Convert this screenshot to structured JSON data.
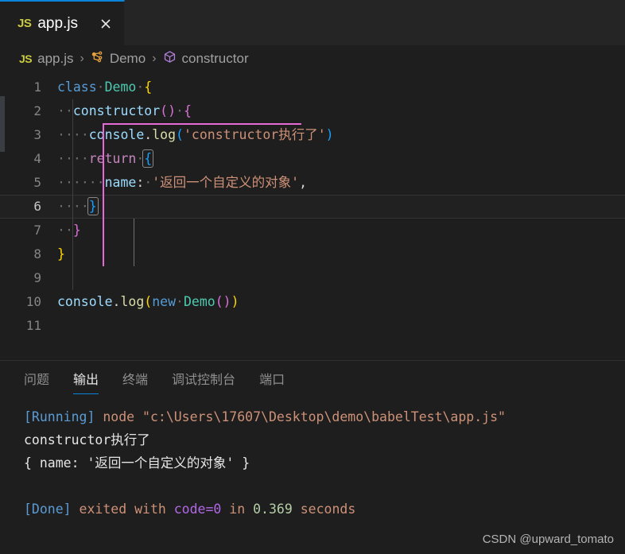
{
  "tab": {
    "file_type_badge": "JS",
    "label": "app.js",
    "close_icon": "close-icon"
  },
  "breadcrumb": {
    "file_type_badge": "JS",
    "file": "app.js",
    "separator": "›",
    "class_name": "Demo",
    "member_name": "constructor"
  },
  "editor": {
    "line_numbers": [
      "1",
      "2",
      "3",
      "4",
      "5",
      "6",
      "7",
      "8",
      "9",
      "10",
      "11"
    ],
    "lines": [
      {
        "n": "1",
        "text": "class Demo {"
      },
      {
        "n": "2",
        "text": "  constructor() {"
      },
      {
        "n": "3",
        "text": "    console.log('constructor执行了')"
      },
      {
        "n": "4",
        "text": "    return {"
      },
      {
        "n": "5",
        "text": "      name: '返回一个自定义的对象',"
      },
      {
        "n": "6",
        "text": "    }"
      },
      {
        "n": "7",
        "text": "  }"
      },
      {
        "n": "8",
        "text": "}"
      },
      {
        "n": "9",
        "text": ""
      },
      {
        "n": "10",
        "text": "console.log(new Demo())"
      },
      {
        "n": "11",
        "text": ""
      }
    ],
    "tokens": {
      "kw_class": "class",
      "class_name": "Demo",
      "brace_open": "{",
      "brace_close": "}",
      "constructor": "constructor",
      "paren_open": "(",
      "paren_close": ")",
      "parens_empty": "()",
      "console": "console",
      "dot": ".",
      "log": "log",
      "string_log": "'constructor执行了'",
      "kw_return": "return",
      "prop_name": "name",
      "colon": ":",
      "string_name": "'返回一个自定义的对象'",
      "comma": ",",
      "kw_new": "new",
      "space_dot": "·"
    }
  },
  "panel": {
    "tabs": [
      {
        "label": "问题",
        "active": false
      },
      {
        "label": "输出",
        "active": true
      },
      {
        "label": "终端",
        "active": false
      },
      {
        "label": "调试控制台",
        "active": false
      },
      {
        "label": "端口",
        "active": false
      }
    ],
    "output": {
      "running_tag": "[Running]",
      "running_cmd": " node ",
      "running_path": "\"c:\\Users\\17607\\Desktop\\demo\\babelTest\\app.js\"",
      "log_line": "constructor执行了",
      "result_line": "{ name: '返回一个自定义的对象' }",
      "done_tag": "[Done]",
      "done_exited": " exited with ",
      "done_code": "code=0",
      "done_in": " in ",
      "done_seconds_value": "0.369",
      "done_seconds_unit": " seconds"
    }
  },
  "watermark": "CSDN @upward_tomato",
  "colors": {
    "accent": "#0a84d8",
    "editor_bg": "#1e1e1e",
    "tabbar_bg": "#252526",
    "keyword": "#569cd6",
    "control": "#c586c0",
    "class": "#4ec9b0",
    "function": "#dcdcaa",
    "variable": "#9cdcfe",
    "string": "#ce9178",
    "bracket1": "#ffd700",
    "bracket2": "#da70d6",
    "bracket3": "#179fff",
    "indent_active": "#e56ad6"
  }
}
